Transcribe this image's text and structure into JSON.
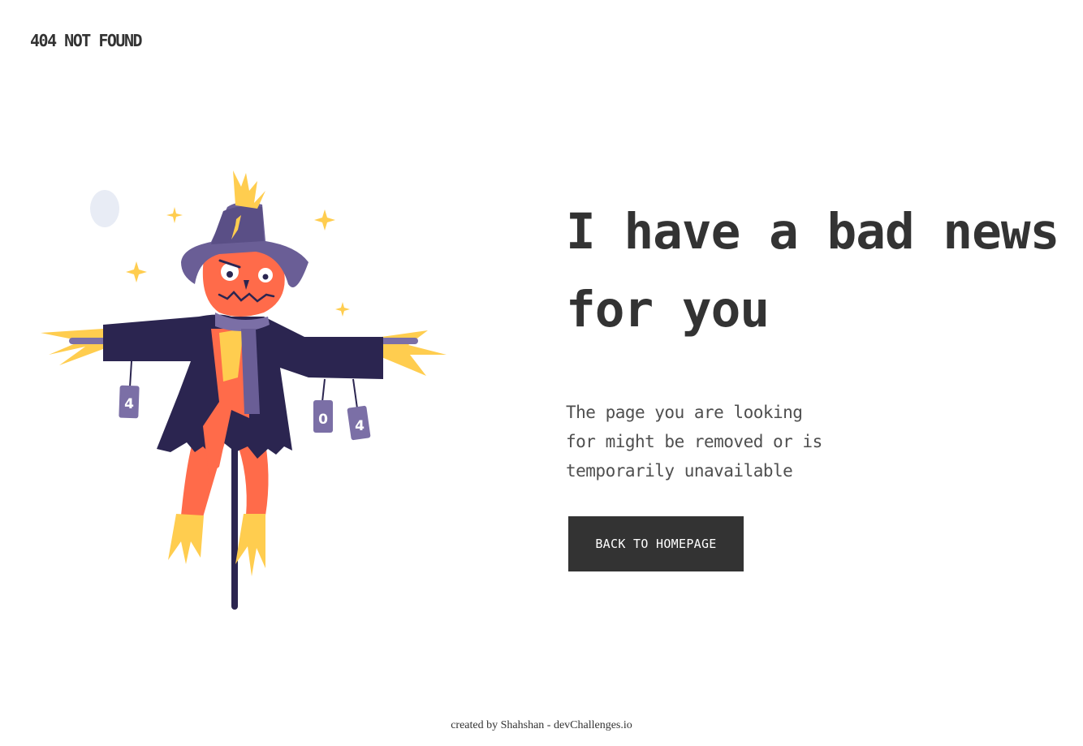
{
  "brand": {
    "title": "404 NOT FOUND"
  },
  "illustration": {
    "can_labels": [
      "4",
      "0",
      "4"
    ]
  },
  "main": {
    "headline_lines": [
      "I have a bad news",
      "for you"
    ],
    "subtitle_lines": [
      "The page you are looking",
      "for might be removed or is",
      "temporarily unavailable"
    ],
    "button_label": "BACK TO HOMEPAGE"
  },
  "footer": {
    "text": "created by Shahshan - devChallenges.io"
  },
  "colors": {
    "text": "#333333",
    "subtext": "#4f4f4f",
    "button_bg": "#333333",
    "button_text": "#ffffff",
    "coat": "#2b2550",
    "hat": "#6a5e96",
    "scarf": "#7b6fa6",
    "face": "#ff6b4a",
    "straw": "#ffcd4f",
    "moon": "#e8ecf5"
  }
}
